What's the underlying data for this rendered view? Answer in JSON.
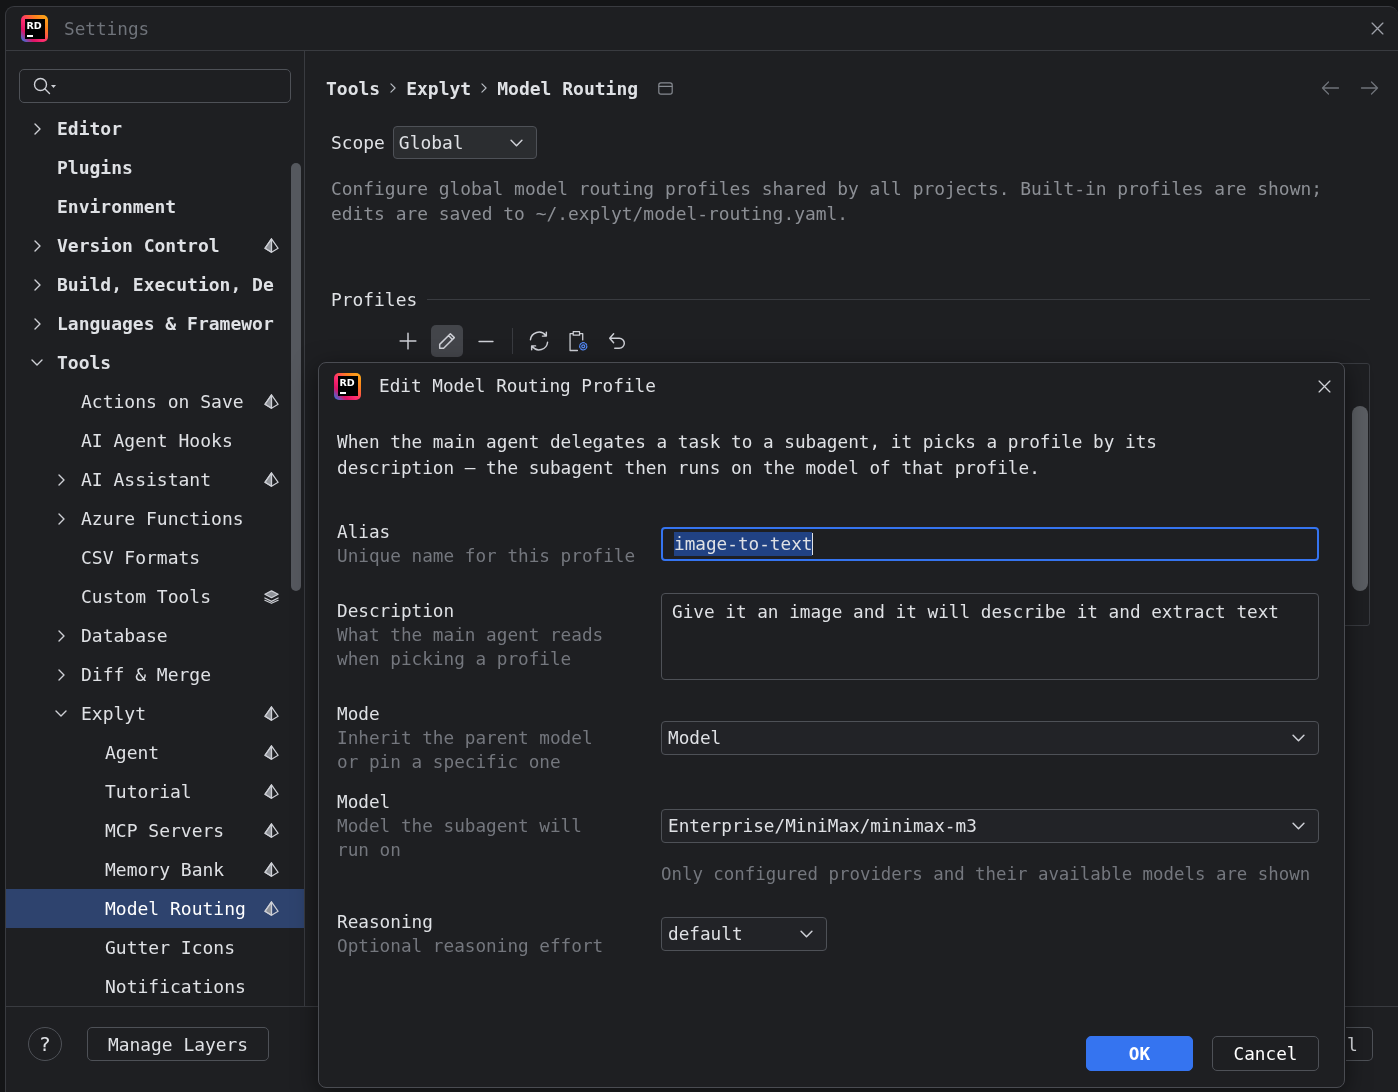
{
  "window": {
    "logo": "RD",
    "title": "Settings"
  },
  "sidebar": {
    "items": [
      {
        "label": "Editor",
        "kind": "plain",
        "expanded": false,
        "selected": false
      },
      {
        "label": "Plugins",
        "kind": "plain",
        "selected": false
      },
      {
        "label": "Environment",
        "kind": "plain",
        "selected": false
      },
      {
        "label": "Version Control",
        "kind": "pyramid",
        "expanded": false,
        "selected": false
      },
      {
        "label": "Build, Execution, De",
        "kind": "plain",
        "expanded": false,
        "selected": false
      },
      {
        "label": "Languages & Framewor",
        "kind": "plain",
        "expanded": false,
        "selected": false
      },
      {
        "label": "Tools",
        "kind": "plain",
        "expanded": true,
        "selected": false,
        "children": [
          {
            "label": "Actions on Save",
            "kind": "pyramid",
            "selected": false
          },
          {
            "label": "AI Agent Hooks",
            "kind": "plain",
            "selected": false
          },
          {
            "label": "AI Assistant",
            "kind": "pyramid",
            "expanded": false,
            "selected": false
          },
          {
            "label": "Azure Functions",
            "kind": "plain",
            "expanded": false,
            "selected": false
          },
          {
            "label": "CSV Formats",
            "kind": "plain",
            "selected": false
          },
          {
            "label": "Custom Tools",
            "kind": "layers",
            "selected": false
          },
          {
            "label": "Database",
            "kind": "plain",
            "expanded": false,
            "selected": false
          },
          {
            "label": "Diff & Merge",
            "kind": "plain",
            "expanded": false,
            "selected": false
          },
          {
            "label": "Explyt",
            "kind": "pyramid",
            "expanded": true,
            "selected": false,
            "children": [
              {
                "label": "Agent",
                "kind": "pyramid",
                "selected": false
              },
              {
                "label": "Tutorial",
                "kind": "pyramid",
                "selected": false
              },
              {
                "label": "MCP Servers",
                "kind": "pyramid",
                "selected": false
              },
              {
                "label": "Memory Bank",
                "kind": "pyramid",
                "selected": false
              },
              {
                "label": "Model Routing",
                "kind": "pyramid",
                "selected": true
              },
              {
                "label": "Gutter Icons",
                "kind": "plain",
                "selected": false
              },
              {
                "label": "Notifications",
                "kind": "plain",
                "selected": false
              }
            ]
          }
        ]
      }
    ]
  },
  "main": {
    "breadcrumb": [
      "Tools",
      "Explyt",
      "Model Routing"
    ],
    "scope": {
      "label": "Scope",
      "value": "Global"
    },
    "description": "Configure global model routing profiles shared by all projects. Built-in profiles are shown;\nedits are saved to ~/.explyt/model-routing.yaml.",
    "profiles": {
      "title": "Profiles",
      "toolbar": [
        {
          "items": [
            {
              "kind": "add",
              "selected": false
            },
            {
              "kind": "edit",
              "selected": true
            },
            {
              "kind": "remove",
              "selected": false
            }
          ]
        },
        {
          "items": [
            {
              "kind": "sync",
              "selected": false
            },
            {
              "kind": "settings",
              "selected": false
            },
            {
              "kind": "revert",
              "selected": false
            }
          ]
        }
      ]
    }
  },
  "bottom_bar": {
    "help": "?",
    "manage_layers": "Manage Layers",
    "hidden_button_fragment": "l"
  },
  "dialog": {
    "logo": "RD",
    "title": "Edit Model Routing Profile",
    "intro": "When the main agent delegates a task to a subagent, it picks a profile by its\ndescription — the subagent then runs on the model of that profile.",
    "fields": [
      {
        "kind": "text",
        "label": "Alias",
        "hint": "Unique name for this profile",
        "value": "image-to-text",
        "focused": true,
        "text_selected": true
      },
      {
        "kind": "textarea",
        "label": "Description",
        "hint": "What the main agent reads\nwhen picking a profile",
        "value": "Give it an image and it will describe it and extract text",
        "focused": false
      },
      {
        "kind": "select",
        "label": "Mode",
        "hint": "Inherit the parent model\nor pin a specific one",
        "value": "Model",
        "compact": false
      },
      {
        "kind": "select",
        "label": "Model",
        "hint": "Model the subagent will\nrun on",
        "value": "Enterprise/MiniMax/minimax-m3",
        "note": "Only configured providers and their available models are shown",
        "compact": false
      },
      {
        "kind": "select",
        "label": "Reasoning",
        "hint": "Optional reasoning effort",
        "value": "default",
        "compact": true
      }
    ],
    "buttons": [
      {
        "label": "OK",
        "primary": true
      },
      {
        "label": "Cancel",
        "primary": false
      }
    ]
  }
}
